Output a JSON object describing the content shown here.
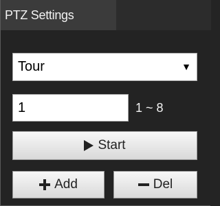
{
  "tab": {
    "title": "PTZ Settings"
  },
  "mode_select": {
    "value": "Tour",
    "arrow": "▼"
  },
  "number_input": {
    "value": "1"
  },
  "range_label": "1 ~ 8",
  "buttons": {
    "start": "Start",
    "add": "Add",
    "del": "Del"
  },
  "icons": {
    "start": "play-icon",
    "add": "plus-icon",
    "del": "minus-icon"
  }
}
